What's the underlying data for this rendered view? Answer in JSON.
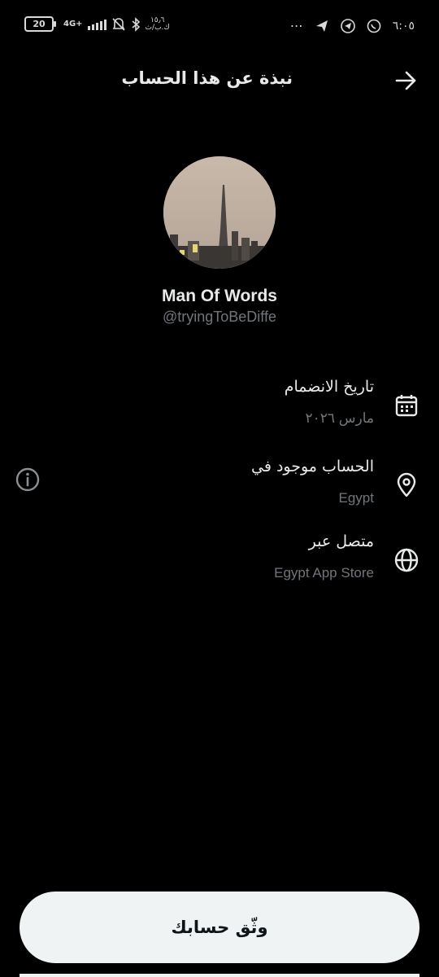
{
  "status_bar": {
    "time": "٦:٠٥",
    "battery": "20",
    "network": "4G+",
    "speed_top": "١٥٫٦",
    "speed_bottom": "ك.ب/ث",
    "icons_right": [
      "whatsapp-icon",
      "telegram-icon",
      "send-icon",
      "more-dots-icon"
    ],
    "icons_left": [
      "battery-icon",
      "signal-icon",
      "mute-icon",
      "bluetooth-icon"
    ],
    "battery_level": 0.2
  },
  "header": {
    "title": "نبذة عن هذا الحساب",
    "back_icon": "arrow-right-icon"
  },
  "profile": {
    "name": "Man Of Words",
    "handle": "@tryingToBeDiffe",
    "avatar_desc_icon": "avatar-image"
  },
  "info": [
    {
      "label": "تاريخ الانضمام",
      "value": "مارس ٢٠٢٦",
      "icon": "calendar-icon"
    },
    {
      "label": "الحساب موجود في",
      "value": "Egypt",
      "icon": "location-pin-icon"
    },
    {
      "label": "متصل عبر",
      "value": "Egypt App Store",
      "icon": "globe-icon"
    }
  ],
  "info_button_icon": "info-icon",
  "verify_button": {
    "label": "وثّق حسابك"
  },
  "colors": {
    "background": "#000000",
    "primary_text": "#e7e9ea",
    "secondary_text": "#71767b",
    "button_bg": "#eff3f4",
    "button_text": "#0f1419"
  }
}
